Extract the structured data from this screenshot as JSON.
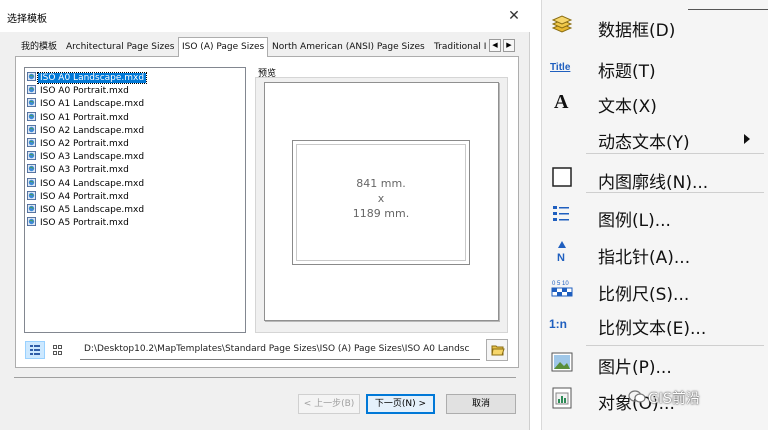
{
  "dialog": {
    "title": "选择模板",
    "tabs": [
      "我的模板",
      "Architectural Page Sizes",
      "ISO (A) Page Sizes",
      "North American (ANSI) Page Sizes",
      "Traditional I"
    ],
    "active_tab": "ISO (A) Page Sizes",
    "templates": [
      "ISO A0 Landscape.mxd",
      "ISO A0 Portrait.mxd",
      "ISO A1 Landscape.mxd",
      "ISO A1 Portrait.mxd",
      "ISO A2 Landscape.mxd",
      "ISO A2 Portrait.mxd",
      "ISO A3 Landscape.mxd",
      "ISO A3 Portrait.mxd",
      "ISO A4 Landscape.mxd",
      "ISO A4 Portrait.mxd",
      "ISO A5 Landscape.mxd",
      "ISO A5 Portrait.mxd"
    ],
    "selected_template": "ISO A0 Landscape.mxd",
    "preview_label": "预览",
    "preview_dims": {
      "line1": "841 mm.",
      "line2": "x",
      "line3": "1189 mm."
    },
    "path": "D:\\Desktop10.2\\MapTemplates\\Standard Page Sizes\\ISO (A) Page Sizes\\ISO A0 Landsc",
    "buttons": {
      "back": "< 上一步(B)",
      "next": "下一页(N) >",
      "cancel": "取消"
    }
  },
  "menu": {
    "items": [
      {
        "icon": "data-frame-icon",
        "label": "数据框(D)"
      },
      {
        "icon": "title-icon",
        "icon_text": "Title",
        "label": "标题(T)"
      },
      {
        "icon": "text-icon",
        "icon_text": "A",
        "label": "文本(X)"
      },
      {
        "icon": "",
        "label": "动态文本(Y)",
        "submenu": true
      },
      {
        "icon": "neatline-icon",
        "label": "内图廓线(N)..."
      },
      {
        "icon": "legend-icon",
        "label": "图例(L)..."
      },
      {
        "icon": "north-arrow-icon",
        "icon_text": "N",
        "label": "指北针(A)..."
      },
      {
        "icon": "scale-bar-icon",
        "label": "比例尺(S)..."
      },
      {
        "icon": "scale-text-icon",
        "icon_text": "1:n",
        "label": "比例文本(E)..."
      },
      {
        "icon": "picture-icon",
        "label": "图片(P)..."
      },
      {
        "icon": "object-icon",
        "label": "对象(O)..."
      }
    ]
  },
  "watermark": "GIS前沿",
  "colors": {
    "selection": "#0078d7",
    "legend_blue": "#1f5fbf",
    "frame_yellow": "#e8b830"
  }
}
